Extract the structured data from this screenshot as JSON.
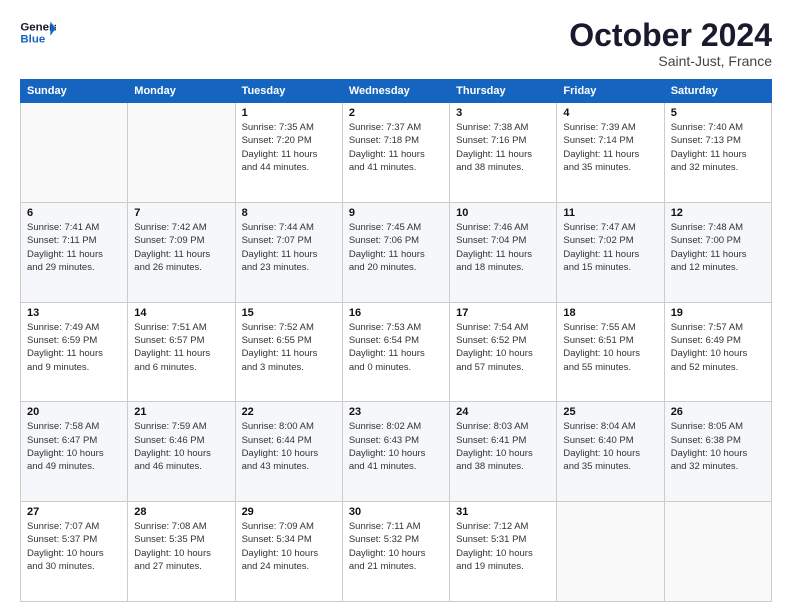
{
  "header": {
    "logo_line1": "General",
    "logo_line2": "Blue",
    "month": "October 2024",
    "location": "Saint-Just, France"
  },
  "weekdays": [
    "Sunday",
    "Monday",
    "Tuesday",
    "Wednesday",
    "Thursday",
    "Friday",
    "Saturday"
  ],
  "weeks": [
    [
      {
        "day": "",
        "detail": ""
      },
      {
        "day": "",
        "detail": ""
      },
      {
        "day": "1",
        "detail": "Sunrise: 7:35 AM\nSunset: 7:20 PM\nDaylight: 11 hours\nand 44 minutes."
      },
      {
        "day": "2",
        "detail": "Sunrise: 7:37 AM\nSunset: 7:18 PM\nDaylight: 11 hours\nand 41 minutes."
      },
      {
        "day": "3",
        "detail": "Sunrise: 7:38 AM\nSunset: 7:16 PM\nDaylight: 11 hours\nand 38 minutes."
      },
      {
        "day": "4",
        "detail": "Sunrise: 7:39 AM\nSunset: 7:14 PM\nDaylight: 11 hours\nand 35 minutes."
      },
      {
        "day": "5",
        "detail": "Sunrise: 7:40 AM\nSunset: 7:13 PM\nDaylight: 11 hours\nand 32 minutes."
      }
    ],
    [
      {
        "day": "6",
        "detail": "Sunrise: 7:41 AM\nSunset: 7:11 PM\nDaylight: 11 hours\nand 29 minutes."
      },
      {
        "day": "7",
        "detail": "Sunrise: 7:42 AM\nSunset: 7:09 PM\nDaylight: 11 hours\nand 26 minutes."
      },
      {
        "day": "8",
        "detail": "Sunrise: 7:44 AM\nSunset: 7:07 PM\nDaylight: 11 hours\nand 23 minutes."
      },
      {
        "day": "9",
        "detail": "Sunrise: 7:45 AM\nSunset: 7:06 PM\nDaylight: 11 hours\nand 20 minutes."
      },
      {
        "day": "10",
        "detail": "Sunrise: 7:46 AM\nSunset: 7:04 PM\nDaylight: 11 hours\nand 18 minutes."
      },
      {
        "day": "11",
        "detail": "Sunrise: 7:47 AM\nSunset: 7:02 PM\nDaylight: 11 hours\nand 15 minutes."
      },
      {
        "day": "12",
        "detail": "Sunrise: 7:48 AM\nSunset: 7:00 PM\nDaylight: 11 hours\nand 12 minutes."
      }
    ],
    [
      {
        "day": "13",
        "detail": "Sunrise: 7:49 AM\nSunset: 6:59 PM\nDaylight: 11 hours\nand 9 minutes."
      },
      {
        "day": "14",
        "detail": "Sunrise: 7:51 AM\nSunset: 6:57 PM\nDaylight: 11 hours\nand 6 minutes."
      },
      {
        "day": "15",
        "detail": "Sunrise: 7:52 AM\nSunset: 6:55 PM\nDaylight: 11 hours\nand 3 minutes."
      },
      {
        "day": "16",
        "detail": "Sunrise: 7:53 AM\nSunset: 6:54 PM\nDaylight: 11 hours\nand 0 minutes."
      },
      {
        "day": "17",
        "detail": "Sunrise: 7:54 AM\nSunset: 6:52 PM\nDaylight: 10 hours\nand 57 minutes."
      },
      {
        "day": "18",
        "detail": "Sunrise: 7:55 AM\nSunset: 6:51 PM\nDaylight: 10 hours\nand 55 minutes."
      },
      {
        "day": "19",
        "detail": "Sunrise: 7:57 AM\nSunset: 6:49 PM\nDaylight: 10 hours\nand 52 minutes."
      }
    ],
    [
      {
        "day": "20",
        "detail": "Sunrise: 7:58 AM\nSunset: 6:47 PM\nDaylight: 10 hours\nand 49 minutes."
      },
      {
        "day": "21",
        "detail": "Sunrise: 7:59 AM\nSunset: 6:46 PM\nDaylight: 10 hours\nand 46 minutes."
      },
      {
        "day": "22",
        "detail": "Sunrise: 8:00 AM\nSunset: 6:44 PM\nDaylight: 10 hours\nand 43 minutes."
      },
      {
        "day": "23",
        "detail": "Sunrise: 8:02 AM\nSunset: 6:43 PM\nDaylight: 10 hours\nand 41 minutes."
      },
      {
        "day": "24",
        "detail": "Sunrise: 8:03 AM\nSunset: 6:41 PM\nDaylight: 10 hours\nand 38 minutes."
      },
      {
        "day": "25",
        "detail": "Sunrise: 8:04 AM\nSunset: 6:40 PM\nDaylight: 10 hours\nand 35 minutes."
      },
      {
        "day": "26",
        "detail": "Sunrise: 8:05 AM\nSunset: 6:38 PM\nDaylight: 10 hours\nand 32 minutes."
      }
    ],
    [
      {
        "day": "27",
        "detail": "Sunrise: 7:07 AM\nSunset: 5:37 PM\nDaylight: 10 hours\nand 30 minutes."
      },
      {
        "day": "28",
        "detail": "Sunrise: 7:08 AM\nSunset: 5:35 PM\nDaylight: 10 hours\nand 27 minutes."
      },
      {
        "day": "29",
        "detail": "Sunrise: 7:09 AM\nSunset: 5:34 PM\nDaylight: 10 hours\nand 24 minutes."
      },
      {
        "day": "30",
        "detail": "Sunrise: 7:11 AM\nSunset: 5:32 PM\nDaylight: 10 hours\nand 21 minutes."
      },
      {
        "day": "31",
        "detail": "Sunrise: 7:12 AM\nSunset: 5:31 PM\nDaylight: 10 hours\nand 19 minutes."
      },
      {
        "day": "",
        "detail": ""
      },
      {
        "day": "",
        "detail": ""
      }
    ]
  ]
}
